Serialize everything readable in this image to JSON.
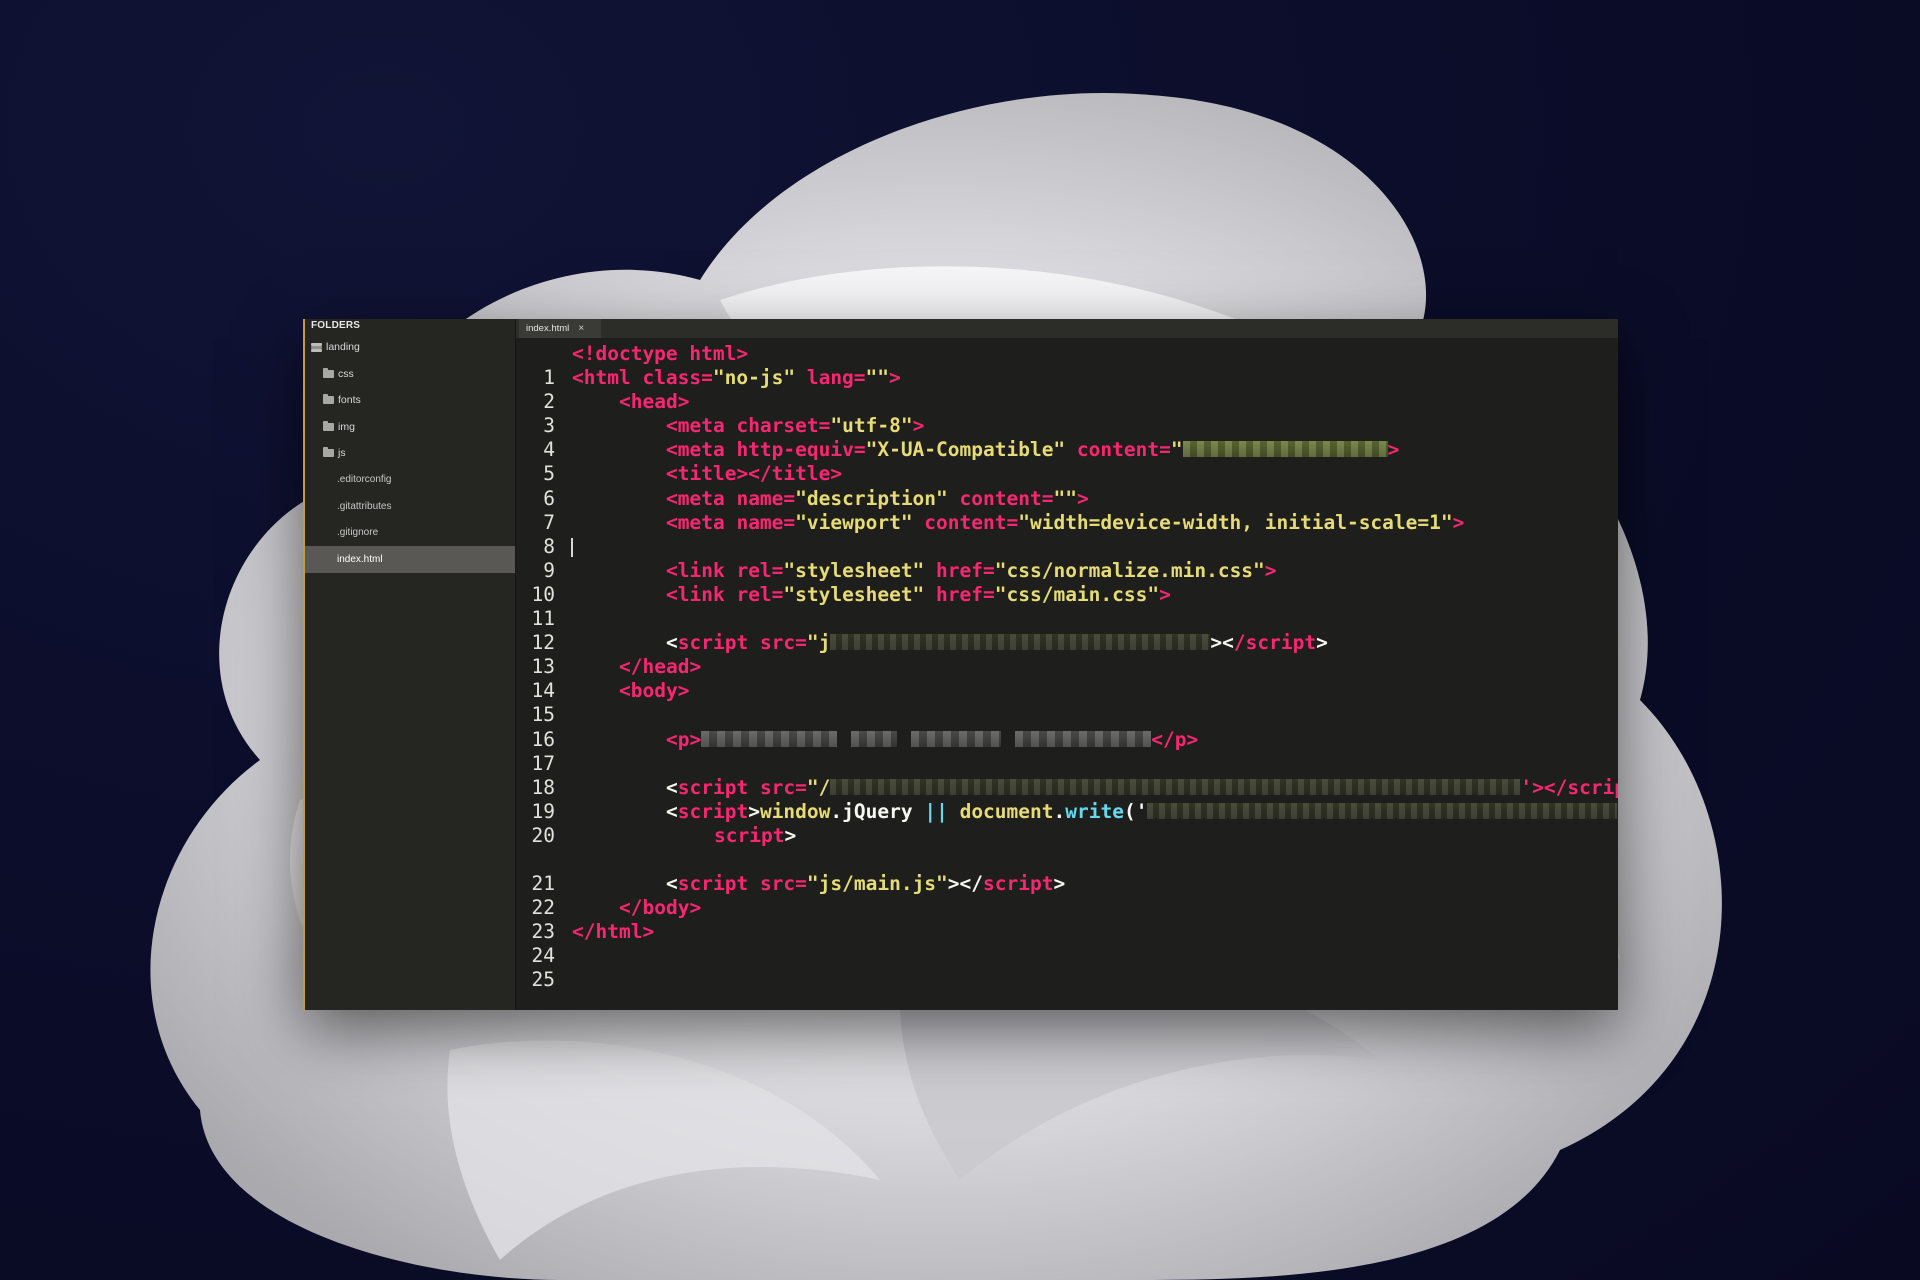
{
  "sidebar": {
    "header": "FOLDERS",
    "items": [
      {
        "label": "landing",
        "kind": "root-folder"
      },
      {
        "label": "css",
        "kind": "folder"
      },
      {
        "label": "fonts",
        "kind": "folder"
      },
      {
        "label": "img",
        "kind": "folder"
      },
      {
        "label": "js",
        "kind": "folder"
      },
      {
        "label": ".editorconfig",
        "kind": "file"
      },
      {
        "label": ".gitattributes",
        "kind": "file"
      },
      {
        "label": ".gitignore",
        "kind": "file"
      },
      {
        "label": "index.html",
        "kind": "file",
        "selected": true
      }
    ]
  },
  "tab": {
    "label": "index.html",
    "close": "×"
  },
  "editor": {
    "line_numbers": [
      "1",
      "2",
      "3",
      "4",
      "5",
      "6",
      "7",
      "8",
      "9",
      "10",
      "11",
      "12",
      "13",
      "14",
      "15",
      "16",
      "17",
      "18",
      "19",
      "20",
      "21",
      "22",
      "23",
      "24",
      "25"
    ],
    "cursor_line": "9",
    "code": {
      "l1": "<!doctype html>",
      "l2_open": "<html ",
      "l2_attr1": "class=",
      "l2_val1": "\"no-js\"",
      "l2_attr2": " lang=",
      "l2_val2": "\"\"",
      "l2_close": ">",
      "l3": "<head>",
      "l4_open": "<meta ",
      "l4_attr": "charset=",
      "l4_val": "\"utf-8\"",
      "l4_close": ">",
      "l5_open": "<meta ",
      "l5_attr1": "http-equiv=",
      "l5_val1": "\"X-UA-Compatible\"",
      "l5_attr2": " content=",
      "l5_val2": "\"",
      "l5_close": ">",
      "l6": "<title></title>",
      "l7_open": "<meta ",
      "l7_attr1": "name=",
      "l7_val1": "\"description\"",
      "l7_attr2": " content=",
      "l7_val2": "\"\"",
      "l7_close": ">",
      "l8_open": "<meta ",
      "l8_attr1": "name=",
      "l8_val1": "\"viewport\"",
      "l8_attr2": " content=",
      "l8_val2": "\"width=device-width, initial-scale=1\"",
      "l8_close": ">",
      "l10_open": "<link ",
      "l10_attr1": "rel=",
      "l10_val1": "\"stylesheet\"",
      "l10_attr2": " href=",
      "l10_val2": "\"css/normalize.min.css\"",
      "l10_close": ">",
      "l11_open": "<link ",
      "l11_attr1": "rel=",
      "l11_val1": "\"stylesheet\"",
      "l11_attr2": " href=",
      "l11_val2": "\"css/main.css\"",
      "l11_close": ">",
      "l13_lt": "<",
      "l13_tag": "script ",
      "l13_attr": "src=",
      "l13_val": "\"j",
      "l13_gt": "><",
      "l13_end": "/script",
      "l13_close": ">",
      "l14": "</head>",
      "l15": "<body>",
      "l17_open": "<p>",
      "l17_close": "</p>",
      "l19_lt": "<",
      "l19_tag": "script ",
      "l19_attr": "src=",
      "l19_val": "\"/",
      "l19_tail": "'></scrip",
      "l20_lt": "<",
      "l20_tag": "script",
      "l20_gt": ">",
      "l20_obj": "window",
      "l20_dot": ".",
      "l20_prop": "jQuery",
      "l20_or": " || ",
      "l20_obj2": "document",
      "l20_dot2": ".",
      "l20_fn": "write",
      "l20_paren": "('",
      "l20b": "script",
      "l20b_gt": ">",
      "l22_lt": "<",
      "l22_tag": "script ",
      "l22_attr": "src=",
      "l22_val": "\"js/main.js\"",
      "l22_gt": "></",
      "l22_end": "script",
      "l22_close": ">",
      "l23": "</body>",
      "l24": "</html>"
    }
  },
  "colors": {
    "tag": "#f92672",
    "string": "#e6db74",
    "text": "#f8f8f2",
    "function": "#66d9ef",
    "editor_bg": "#1e1f1c",
    "sidebar_bg": "#252522",
    "selection": "#5a5855",
    "wallpaper_bg": "#0b0d2a"
  }
}
